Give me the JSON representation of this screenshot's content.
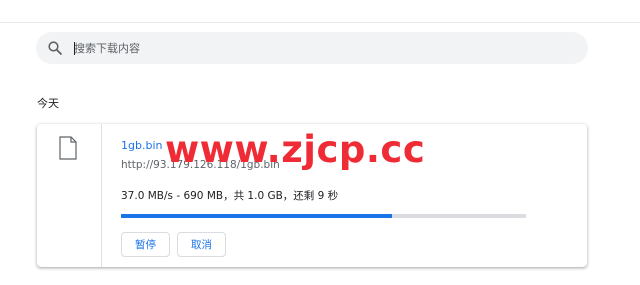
{
  "search": {
    "placeholder": "搜索下载内容",
    "icon": "search-icon"
  },
  "date_group": {
    "header": "今天"
  },
  "download": {
    "file_name": "1gb.bin",
    "url": "http://93.179.126.118/1gb.bin",
    "status": "37.0 MB/s - 690 MB，共 1.0 GB，还剩 9 秒",
    "progress_fraction": 0.67,
    "file_icon": "file-icon",
    "buttons": {
      "pause_label": "暂停",
      "cancel_label": "取消"
    }
  },
  "watermark": {
    "text": "www.zjcp.cc"
  },
  "colors": {
    "accent": "#1a73e8",
    "watermark": "#ef2b35",
    "track": "#dadce0",
    "search_bg": "#f1f3f4"
  }
}
